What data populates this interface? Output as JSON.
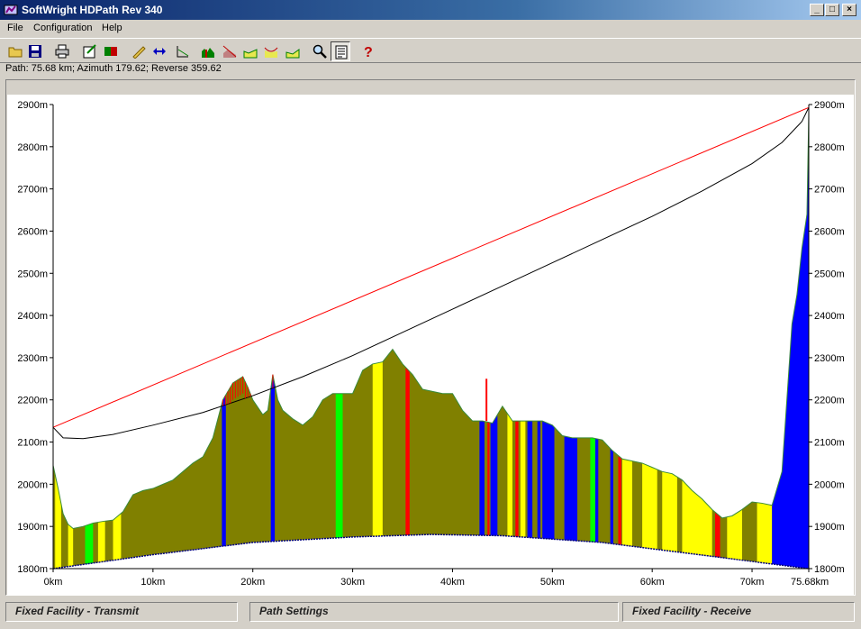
{
  "window": {
    "title": "SoftWright HDPath Rev 340",
    "buttons": {
      "minimize": "_",
      "maximize": "□",
      "close": "×"
    }
  },
  "menu": [
    {
      "label": "File"
    },
    {
      "label": "Configuration"
    },
    {
      "label": "Help"
    }
  ],
  "toolbar": [
    {
      "name": "open-icon"
    },
    {
      "name": "save-icon"
    },
    {
      "name": "print-icon"
    },
    {
      "name": "edit-icon"
    },
    {
      "name": "export-icon"
    },
    {
      "name": "pencil-icon"
    },
    {
      "name": "swap-icon"
    },
    {
      "name": "profile-icon"
    },
    {
      "name": "terrain-icon"
    },
    {
      "name": "fresnel-icon"
    },
    {
      "name": "clutter-icon"
    },
    {
      "name": "curve-icon"
    },
    {
      "name": "area-icon"
    },
    {
      "name": "zoom-icon"
    },
    {
      "name": "report-icon"
    },
    {
      "name": "help-icon"
    }
  ],
  "status": "Path: 75.68 km; Azimuth 179.62; Reverse 359.62",
  "panels": {
    "left": "Fixed Facility - Transmit",
    "middle": "Path Settings",
    "right": "Fixed Facility - Receive"
  },
  "chart_data": {
    "type": "area",
    "title": "",
    "ylim": [
      1800,
      2900
    ],
    "xlim": [
      0,
      75.68
    ],
    "y_ticks": [
      "1800m",
      "1900m",
      "2000m",
      "2100m",
      "2200m",
      "2300m",
      "2400m",
      "2500m",
      "2600m",
      "2700m",
      "2800m",
      "2900m"
    ],
    "x_ticks": [
      {
        "value": 0,
        "label": "0km"
      },
      {
        "value": 10,
        "label": "10km"
      },
      {
        "value": 20,
        "label": "20km"
      },
      {
        "value": 30,
        "label": "30km"
      },
      {
        "value": 40,
        "label": "40km"
      },
      {
        "value": 50,
        "label": "50km"
      },
      {
        "value": 60,
        "label": "60km"
      },
      {
        "value": 70,
        "label": "70km"
      },
      {
        "value": 75.68,
        "label": "75.68km"
      }
    ],
    "colors": {
      "terrain": "#808000",
      "yellow": "#ffff00",
      "blue": "#0000ff",
      "green": "#00ff00",
      "red": "#ff0000",
      "los": "#ff0000",
      "curve": "#000000",
      "baseline": "#00007f"
    },
    "line_of_sight": {
      "x": [
        0,
        75.68
      ],
      "y": [
        2135,
        2893
      ]
    },
    "terrain": {
      "x": [
        0,
        0.5,
        1,
        1.5,
        2,
        3,
        4,
        5,
        6,
        7,
        8,
        9,
        10,
        11,
        12,
        13,
        14,
        15,
        16,
        17,
        18,
        19,
        19.5,
        20,
        21,
        21.5,
        22,
        22.5,
        23,
        24,
        25,
        26,
        27,
        28,
        29,
        30,
        31,
        32,
        33,
        34,
        35,
        36,
        37,
        38,
        39,
        40,
        41,
        42,
        43,
        44,
        45,
        46,
        47,
        48,
        49,
        50,
        51,
        52,
        53,
        54,
        55,
        56,
        57,
        58,
        59,
        60,
        61,
        62,
        63,
        64,
        65,
        66,
        67,
        68,
        69,
        70,
        71,
        72,
        73,
        74,
        74.5,
        75,
        75.5,
        75.68
      ],
      "y": [
        2045,
        1990,
        1930,
        1905,
        1895,
        1900,
        1908,
        1912,
        1915,
        1935,
        1975,
        1985,
        1990,
        2000,
        2010,
        2030,
        2050,
        2065,
        2110,
        2200,
        2240,
        2255,
        2230,
        2200,
        2165,
        2175,
        2260,
        2200,
        2175,
        2155,
        2140,
        2160,
        2200,
        2215,
        2215,
        2215,
        2270,
        2285,
        2290,
        2320,
        2285,
        2260,
        2225,
        2220,
        2215,
        2215,
        2175,
        2150,
        2150,
        2145,
        2185,
        2150,
        2150,
        2150,
        2150,
        2140,
        2115,
        2110,
        2110,
        2110,
        2105,
        2080,
        2060,
        2055,
        2050,
        2040,
        2030,
        2025,
        2010,
        1985,
        1965,
        1940,
        1920,
        1925,
        1940,
        1958,
        1955,
        1950,
        2030,
        2380,
        2450,
        2560,
        2640,
        2880
      ]
    },
    "earth_bulge": [
      {
        "x": 0,
        "y": 1800
      },
      {
        "x": 10,
        "y": 1833
      },
      {
        "x": 20,
        "y": 1862
      },
      {
        "x": 30,
        "y": 1875
      },
      {
        "x": 37.84,
        "y": 1881
      },
      {
        "x": 45,
        "y": 1878
      },
      {
        "x": 55,
        "y": 1862
      },
      {
        "x": 65,
        "y": 1832
      },
      {
        "x": 75.68,
        "y": 1800
      }
    ],
    "fresnel_curve": [
      {
        "x": 0,
        "y": 2135
      },
      {
        "x": 1,
        "y": 2110
      },
      {
        "x": 3,
        "y": 2108
      },
      {
        "x": 6,
        "y": 2118
      },
      {
        "x": 10,
        "y": 2140
      },
      {
        "x": 15,
        "y": 2170
      },
      {
        "x": 20,
        "y": 2210
      },
      {
        "x": 25,
        "y": 2255
      },
      {
        "x": 30,
        "y": 2305
      },
      {
        "x": 35,
        "y": 2360
      },
      {
        "x": 40,
        "y": 2415
      },
      {
        "x": 45,
        "y": 2470
      },
      {
        "x": 50,
        "y": 2525
      },
      {
        "x": 55,
        "y": 2580
      },
      {
        "x": 60,
        "y": 2635
      },
      {
        "x": 65,
        "y": 2695
      },
      {
        "x": 70,
        "y": 2760
      },
      {
        "x": 73,
        "y": 2810
      },
      {
        "x": 75,
        "y": 2860
      },
      {
        "x": 75.68,
        "y": 2893
      }
    ],
    "obstructions": [
      {
        "x": [
          19.5,
          22
        ],
        "label": ""
      },
      {
        "x": 22,
        "label": ""
      },
      {
        "x": 26.5,
        "label": ""
      },
      {
        "x": 30,
        "label": ""
      },
      {
        "x": 33,
        "label": ""
      },
      {
        "x": 64,
        "label": ""
      }
    ],
    "bands": [
      {
        "x0": 0.2,
        "x1": 0.8,
        "color": "yellow"
      },
      {
        "x0": 1.5,
        "x1": 2,
        "color": "yellow"
      },
      {
        "x0": 3.2,
        "x1": 4,
        "color": "green"
      },
      {
        "x0": 4.5,
        "x1": 5.2,
        "color": "yellow"
      },
      {
        "x0": 6,
        "x1": 6.8,
        "color": "yellow"
      },
      {
        "x0": 16.9,
        "x1": 17.3,
        "color": "blue"
      },
      {
        "x0": 21.8,
        "x1": 22.2,
        "color": "blue"
      },
      {
        "x0": 28.3,
        "x1": 29,
        "color": "green"
      },
      {
        "x0": 32,
        "x1": 33,
        "color": "yellow"
      },
      {
        "x0": 35.3,
        "x1": 35.7,
        "color": "red"
      },
      {
        "x0": 42.7,
        "x1": 43.2,
        "color": "blue"
      },
      {
        "x0": 43.5,
        "x1": 43.7,
        "color": "red"
      },
      {
        "x0": 43.8,
        "x1": 44.5,
        "color": "blue"
      },
      {
        "x0": 45.5,
        "x1": 46,
        "color": "yellow"
      },
      {
        "x0": 46.3,
        "x1": 46.6,
        "color": "red"
      },
      {
        "x0": 46.8,
        "x1": 47.3,
        "color": "yellow"
      },
      {
        "x0": 47.5,
        "x1": 48,
        "color": "blue"
      },
      {
        "x0": 48.5,
        "x1": 48.8,
        "color": "blue"
      },
      {
        "x0": 49,
        "x1": 50.2,
        "color": "blue"
      },
      {
        "x0": 51.2,
        "x1": 52.5,
        "color": "blue"
      },
      {
        "x0": 53.8,
        "x1": 54.3,
        "color": "green"
      },
      {
        "x0": 54.3,
        "x1": 54.6,
        "color": "blue"
      },
      {
        "x0": 55.8,
        "x1": 56.1,
        "color": "blue"
      },
      {
        "x0": 56.6,
        "x1": 56.9,
        "color": "red"
      },
      {
        "x0": 57,
        "x1": 58,
        "color": "yellow"
      },
      {
        "x0": 59,
        "x1": 60.5,
        "color": "yellow"
      },
      {
        "x0": 61,
        "x1": 62.5,
        "color": "yellow"
      },
      {
        "x0": 63,
        "x1": 66,
        "color": "yellow"
      },
      {
        "x0": 66.3,
        "x1": 66.8,
        "color": "red"
      },
      {
        "x0": 67.5,
        "x1": 69,
        "color": "yellow"
      },
      {
        "x0": 70.5,
        "x1": 72,
        "color": "yellow"
      },
      {
        "x0": 72,
        "x1": 75.68,
        "color": "blue"
      }
    ]
  }
}
